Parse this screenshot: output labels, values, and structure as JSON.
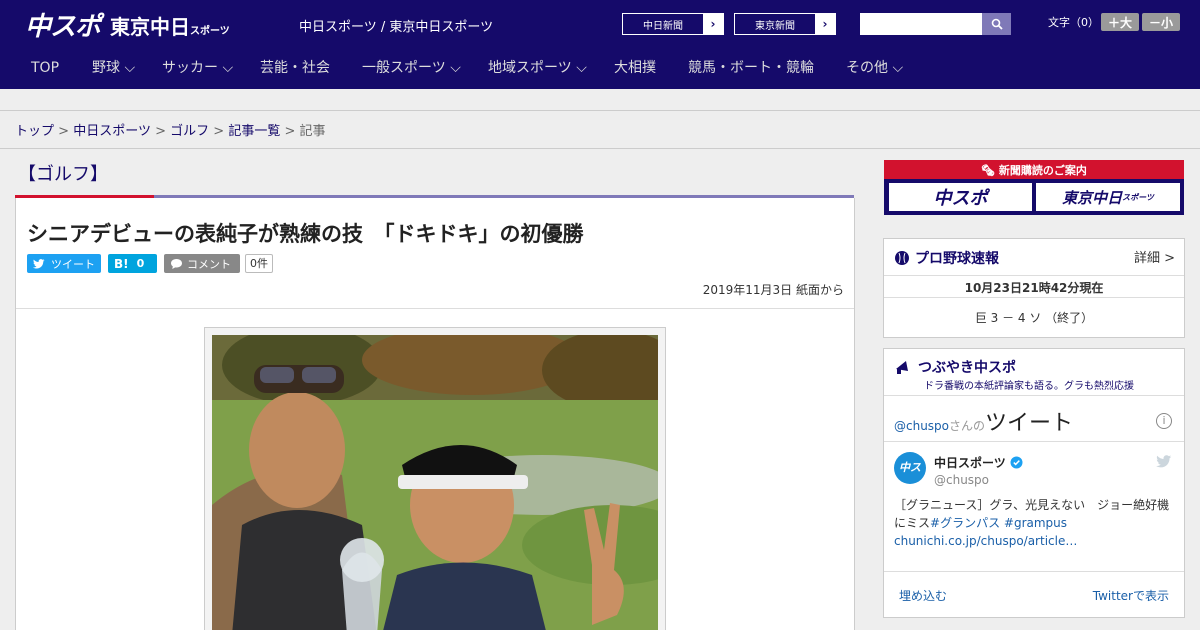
{
  "header": {
    "logo_main": "中スポ",
    "logo_tokyo": "東京中日",
    "logo_tokyo_small": "スポーツ",
    "tagline": "中日スポーツ / 東京中日スポーツ",
    "newspaper_buttons": [
      "中日新聞",
      "東京新聞"
    ],
    "search_placeholder": "",
    "font_size_label": "文字（0）",
    "font_plus_label": "＋大",
    "font_minus_label": "－小"
  },
  "nav": {
    "items": [
      {
        "label": "TOP",
        "dropdown": false
      },
      {
        "label": "野球",
        "dropdown": true
      },
      {
        "label": "サッカー",
        "dropdown": true
      },
      {
        "label": "芸能・社会",
        "dropdown": false
      },
      {
        "label": "一般スポーツ",
        "dropdown": true
      },
      {
        "label": "地域スポーツ",
        "dropdown": true
      },
      {
        "label": "大相撲",
        "dropdown": false
      },
      {
        "label": "競馬・ボート・競輪",
        "dropdown": false
      },
      {
        "label": "その他",
        "dropdown": true
      }
    ]
  },
  "breadcrumb": {
    "items": [
      "トップ",
      "中日スポーツ",
      "ゴルフ",
      "記事一覧"
    ],
    "current": "記事",
    "separator": ">"
  },
  "article": {
    "category": "【ゴルフ】",
    "headline": "シニアデビューの表純子が熟練の技　「ドキドキ」の初優勝",
    "tweet_label": "ツイート",
    "hatena_label": "B!",
    "hatena_count": "0",
    "comment_label": "コメント",
    "comment_count": "0件",
    "date": "2019年11月3日 紙面から"
  },
  "sidebar": {
    "ad_title": "新聞購読のご案内",
    "ad_left": "中スポ",
    "ad_right": "東京中日",
    "ad_right_small": "スポーツ",
    "baseball": {
      "title": "プロ野球速報",
      "detail_link": "詳細 >",
      "timestamp": "10月23日21時42分現在",
      "score": "巨 3 － 4 ソ （終了）"
    },
    "twitter": {
      "title": "つぶやき中スポ",
      "subtitle": "ドラ番戦の本紙評論家も語る。グラも熱烈応援",
      "handle_prefix": "@chuspo",
      "handle_suffix": "さんの",
      "tweets_label": "ツイート",
      "account_name": "中日スポーツ",
      "account_handle": "@chuspo",
      "tweet_text": "［グラニュース］グラ、光見えない　ジョー絶好機にミス",
      "hashtag1": "#グランパス",
      "hashtag2": "#grampus",
      "tweet_link": "chunichi.co.jp/chuspo/article…",
      "embed_label": "埋め込む",
      "view_on_twitter": "Twitterで表示"
    }
  },
  "colors": {
    "brand_navy": "#150a6a",
    "accent_red": "#d2122e",
    "twitter_blue": "#1da1f2",
    "hatena_blue": "#00a4de"
  }
}
